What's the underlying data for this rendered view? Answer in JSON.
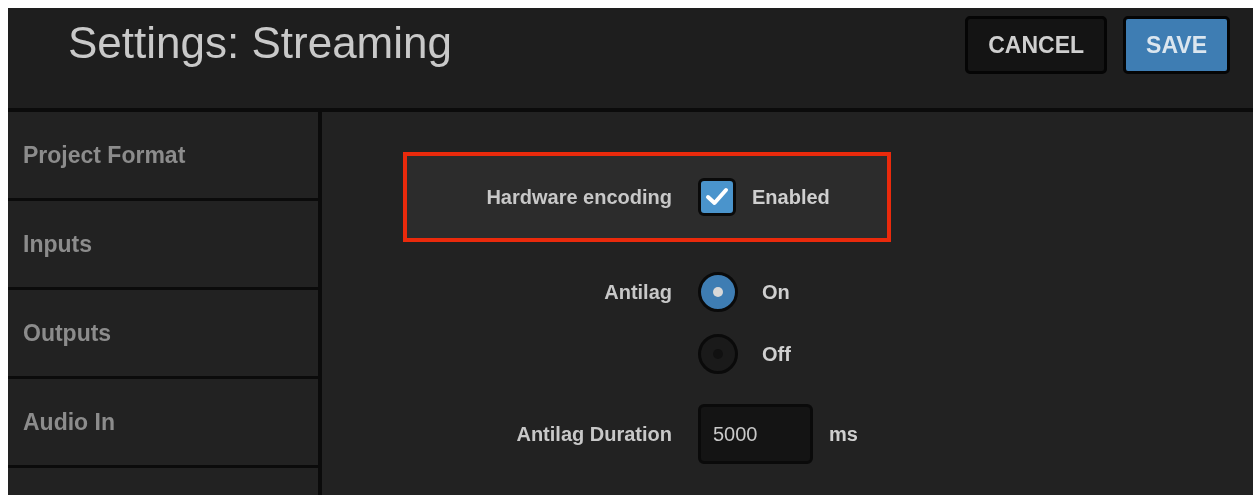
{
  "window": {
    "title": "Settings: Streaming"
  },
  "buttons": [
    {
      "label": "CANCEL",
      "kind": "secondary"
    },
    {
      "label": "SAVE",
      "kind": "primary"
    }
  ],
  "sidebar": {
    "items": [
      {
        "label": "Project Format"
      },
      {
        "label": "Inputs"
      },
      {
        "label": "Outputs"
      },
      {
        "label": "Audio In"
      }
    ]
  },
  "hardware_encoding": {
    "label": "Hardware encoding",
    "checked": true,
    "option_label": "Enabled",
    "highlighted": true
  },
  "antilag": {
    "label": "Antilag",
    "options": [
      {
        "label": "On",
        "selected": true
      },
      {
        "label": "Off",
        "selected": false
      }
    ]
  },
  "antilag_duration": {
    "label": "Antilag Duration",
    "value": "5000",
    "unit": "ms"
  }
}
